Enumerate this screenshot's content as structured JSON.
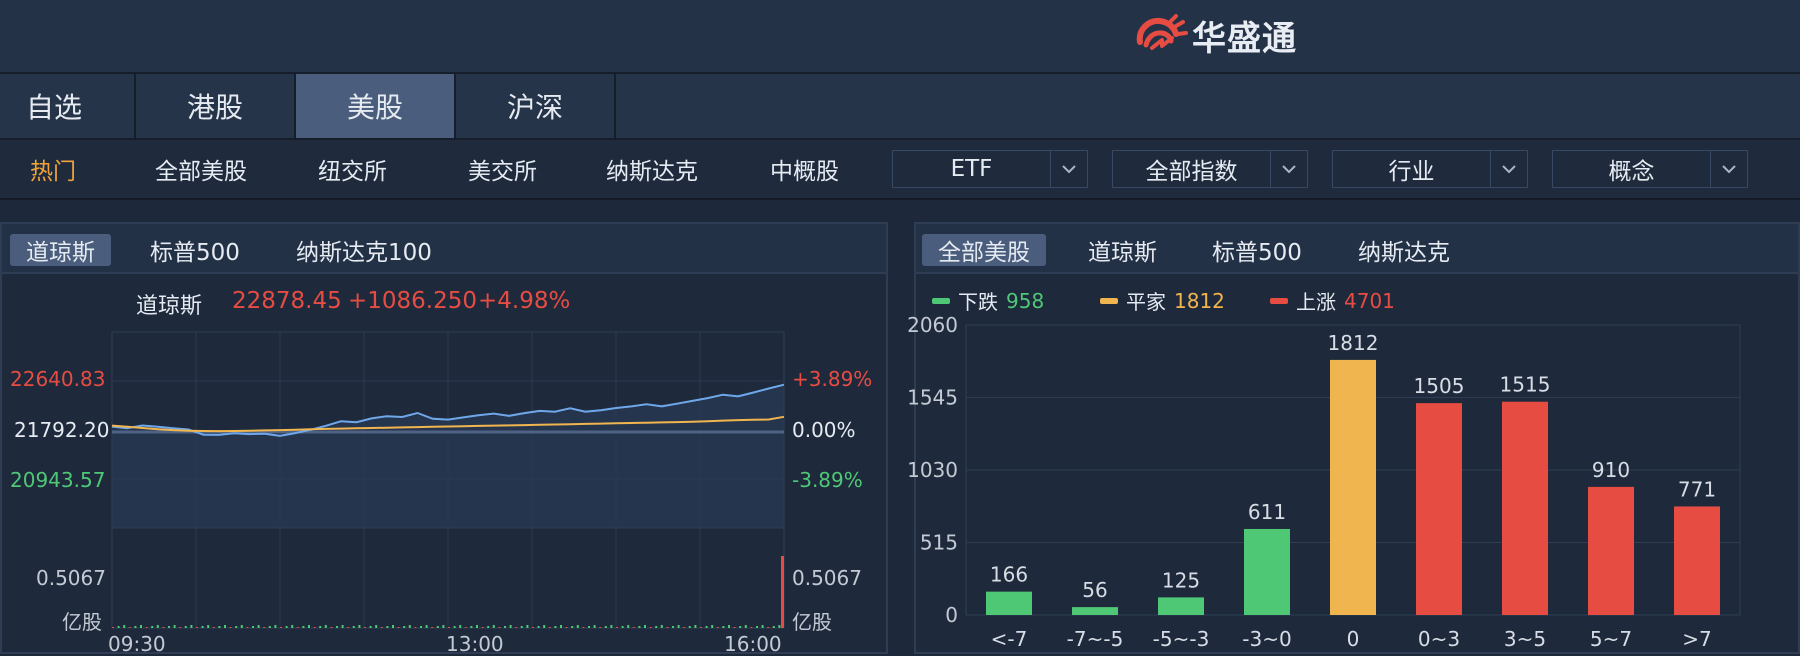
{
  "header": {
    "logo_text": "华盛通"
  },
  "market_tabs": [
    {
      "label": "自选",
      "active": false
    },
    {
      "label": "港股",
      "active": false
    },
    {
      "label": "美股",
      "active": true
    },
    {
      "label": "沪深",
      "active": false
    }
  ],
  "sub_nav": {
    "links": [
      "热门",
      "全部美股",
      "纽交所",
      "美交所",
      "纳斯达克",
      "中概股"
    ],
    "dropdowns": [
      "ETF",
      "全部指数",
      "行业",
      "概念"
    ]
  },
  "index_panel": {
    "tabs": [
      "道琼斯",
      "标普500",
      "纳斯达克100"
    ],
    "active_tab": 0,
    "quote": {
      "name": "道琼斯",
      "price": "22878.45",
      "change": "+1086.250",
      "pct": "+4.98%"
    },
    "y_left": {
      "high": "22640.83",
      "mid": "21792.20",
      "low": "20943.57"
    },
    "y_right": {
      "high": "+3.89%",
      "mid": "0.00%",
      "low": "-3.89%"
    },
    "volume": {
      "max_left": "0.5067",
      "unit_left": "亿股",
      "max_right": "0.5067",
      "unit_right": "亿股"
    },
    "time_labels": [
      "09:30",
      "13:00",
      "16:00"
    ],
    "colors": {
      "price_line": "#6fa8ea",
      "avg_line": "#f0b54f",
      "baseline": "#4e6384"
    }
  },
  "distribution_panel": {
    "tabs": [
      "全部美股",
      "道琼斯",
      "标普500",
      "纳斯达克"
    ],
    "active_tab": 0,
    "legend": [
      {
        "label": "下跌",
        "value": "958",
        "color": "#4fc876"
      },
      {
        "label": "平家",
        "value": "1812",
        "color": "#f0b54f"
      },
      {
        "label": "上涨",
        "value": "4701",
        "color": "#e74c43"
      }
    ]
  },
  "chart_data": [
    {
      "type": "bar",
      "categories": [
        "<-7",
        "-7~-5",
        "-5~-3",
        "-3~0",
        "0",
        "0~3",
        "3~5",
        "5~7",
        ">7"
      ],
      "values": [
        166,
        56,
        125,
        611,
        1812,
        1505,
        1515,
        910,
        771
      ],
      "colors": [
        "#4fc876",
        "#4fc876",
        "#4fc876",
        "#4fc876",
        "#f0b54f",
        "#e74c43",
        "#e74c43",
        "#e74c43",
        "#e74c43"
      ],
      "yticks": [
        0,
        515,
        1030,
        1545,
        2060
      ],
      "ylim": [
        0,
        2060
      ]
    },
    {
      "type": "line",
      "x": [
        "09:30",
        "13:00",
        "16:00"
      ],
      "ylim": [
        20943.57,
        22640.83
      ],
      "baseline": 21792.2,
      "y_pct": [
        -3.89,
        3.89
      ],
      "series": [
        {
          "values": [
            21850,
            21890,
            21920,
            21880,
            21840,
            21800,
            21780,
            21760,
            21770,
            21740,
            21730,
            21760,
            21790,
            21830,
            21880,
            21940,
            21990,
            22040,
            22060,
            22030,
            22080,
            22050,
            22020,
            22040,
            22060,
            22070,
            22100,
            22130,
            22150,
            22120,
            22160,
            22170,
            22180,
            22200,
            22210,
            22230,
            22260,
            22290,
            22320,
            22350,
            22390,
            22430,
            22480,
            22530,
            22578
          ]
        },
        {
          "values": [
            21900,
            21880,
            21860,
            21840,
            21825,
            21815,
            21810,
            21808,
            21810,
            21815,
            21820,
            21825,
            21830,
            21838,
            21845,
            21850,
            21855,
            21860,
            21865,
            21870,
            21875,
            21880,
            21885,
            21890,
            21895,
            21900,
            21905,
            21910,
            21915,
            21920,
            21925,
            21930,
            21935,
            21940,
            21945,
            21950,
            21955,
            21960,
            21965,
            21975,
            21985,
            21995,
            22000,
            22005,
            22050
          ]
        }
      ]
    }
  ]
}
